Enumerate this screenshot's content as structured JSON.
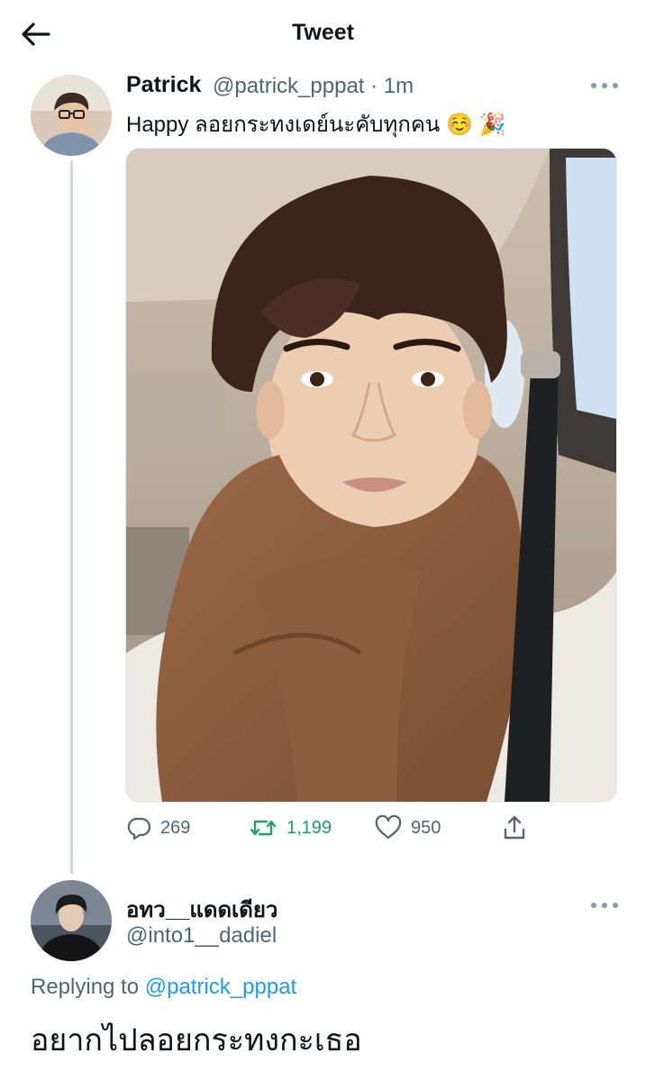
{
  "header": {
    "title": "Tweet"
  },
  "tweet": {
    "author_name": "Patrick",
    "author_handle": "@patrick_pppat · 1m",
    "text": "Happy ลอยกระทงเดย์นะคับทุกคน ☺️ 🎉",
    "actions": {
      "replies": "269",
      "retweets": "1,199",
      "likes": "950"
    }
  },
  "reply": {
    "author_name": "อทว__แดดเดียว",
    "author_handle": "@into1__dadiel",
    "replying_prefix": "Replying to",
    "replying_handle": "@patrick_pppat",
    "text": "อยากไปลอยกระทงกะเธอ"
  },
  "colors": {
    "retweet": "#17a36a",
    "link": "#1d9bf0",
    "muted": "#536471",
    "thread_line": "#cfd9de"
  },
  "icons": [
    "back-arrow-icon",
    "more-icon",
    "reply-icon",
    "retweet-icon",
    "like-icon",
    "share-icon"
  ]
}
